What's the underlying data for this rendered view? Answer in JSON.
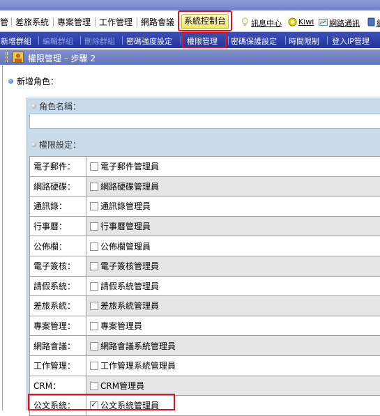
{
  "main_nav": {
    "items": [
      "管",
      "差旅系統",
      "專案管理",
      "工作管理",
      "網路會議"
    ],
    "active_tab": "系統控制台",
    "util_links": [
      "訊息中心",
      "Kiwi",
      "網路通訊",
      "網"
    ]
  },
  "sub_nav": {
    "items": [
      "新增群組",
      "編輯群組",
      "刪除群組",
      "密碼強度設定",
      "權限管理",
      "密碼保護設定",
      "時間限制",
      "登入IP管理"
    ],
    "active": "權限管理"
  },
  "breadcrumb": "權限管理 – 步驟 2",
  "form": {
    "section_title": "新增角色：",
    "role_name_label": "角色名稱：",
    "role_name_value": "",
    "perm_label": "權限設定：",
    "permissions": [
      {
        "category": "電子郵件：",
        "option": "電子郵件管理員",
        "checked": false
      },
      {
        "category": "網路硬碟：",
        "option": "網路硬碟管理員",
        "checked": false
      },
      {
        "category": "通訊錄：",
        "option": "通訊錄管理員",
        "checked": false
      },
      {
        "category": "行事曆：",
        "option": "行事曆管理員",
        "checked": false
      },
      {
        "category": "公佈欄：",
        "option": "公佈欄管理員",
        "checked": false
      },
      {
        "category": "電子簽核：",
        "option": "電子簽核管理員",
        "checked": false
      },
      {
        "category": "請假系統：",
        "option": "請假系統管理員",
        "checked": false
      },
      {
        "category": "差旅系統：",
        "option": "差旅系統管理員",
        "checked": false
      },
      {
        "category": "專案管理：",
        "option": "專案管理員",
        "checked": false
      },
      {
        "category": "網路會議：",
        "option": "網路會議系統管理員",
        "checked": false
      },
      {
        "category": "工作管理：",
        "option": "工作管理系統管理員",
        "checked": false
      },
      {
        "category": "CRM：",
        "option": "CRM管理員",
        "checked": false
      },
      {
        "category": "公文系統：",
        "option": "公文系統管理員",
        "checked": true
      }
    ]
  }
}
